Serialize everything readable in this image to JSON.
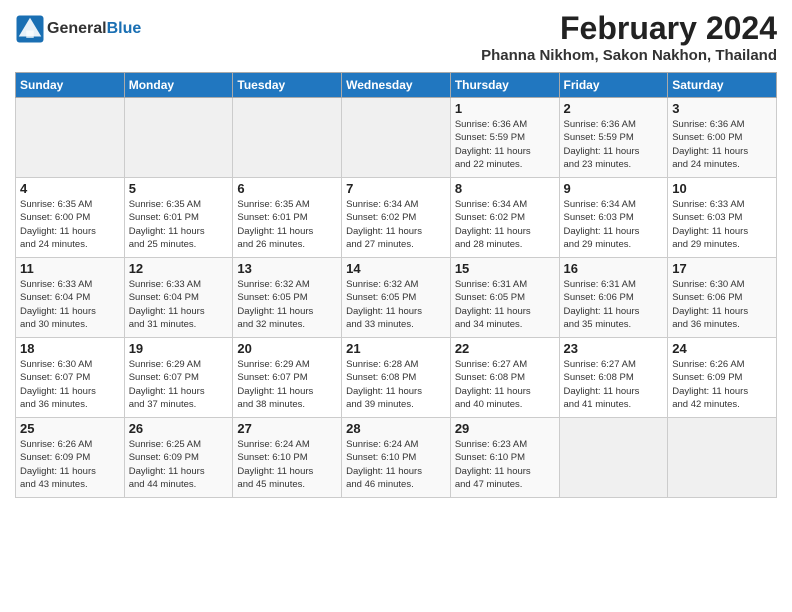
{
  "header": {
    "logo_line1": "General",
    "logo_line2": "Blue",
    "title": "February 2024",
    "subtitle": "Phanna Nikhom, Sakon Nakhon, Thailand"
  },
  "days_of_week": [
    "Sunday",
    "Monday",
    "Tuesday",
    "Wednesday",
    "Thursday",
    "Friday",
    "Saturday"
  ],
  "weeks": [
    [
      {
        "num": "",
        "info": ""
      },
      {
        "num": "",
        "info": ""
      },
      {
        "num": "",
        "info": ""
      },
      {
        "num": "",
        "info": ""
      },
      {
        "num": "1",
        "info": "Sunrise: 6:36 AM\nSunset: 5:59 PM\nDaylight: 11 hours\nand 22 minutes."
      },
      {
        "num": "2",
        "info": "Sunrise: 6:36 AM\nSunset: 5:59 PM\nDaylight: 11 hours\nand 23 minutes."
      },
      {
        "num": "3",
        "info": "Sunrise: 6:36 AM\nSunset: 6:00 PM\nDaylight: 11 hours\nand 24 minutes."
      }
    ],
    [
      {
        "num": "4",
        "info": "Sunrise: 6:35 AM\nSunset: 6:00 PM\nDaylight: 11 hours\nand 24 minutes."
      },
      {
        "num": "5",
        "info": "Sunrise: 6:35 AM\nSunset: 6:01 PM\nDaylight: 11 hours\nand 25 minutes."
      },
      {
        "num": "6",
        "info": "Sunrise: 6:35 AM\nSunset: 6:01 PM\nDaylight: 11 hours\nand 26 minutes."
      },
      {
        "num": "7",
        "info": "Sunrise: 6:34 AM\nSunset: 6:02 PM\nDaylight: 11 hours\nand 27 minutes."
      },
      {
        "num": "8",
        "info": "Sunrise: 6:34 AM\nSunset: 6:02 PM\nDaylight: 11 hours\nand 28 minutes."
      },
      {
        "num": "9",
        "info": "Sunrise: 6:34 AM\nSunset: 6:03 PM\nDaylight: 11 hours\nand 29 minutes."
      },
      {
        "num": "10",
        "info": "Sunrise: 6:33 AM\nSunset: 6:03 PM\nDaylight: 11 hours\nand 29 minutes."
      }
    ],
    [
      {
        "num": "11",
        "info": "Sunrise: 6:33 AM\nSunset: 6:04 PM\nDaylight: 11 hours\nand 30 minutes."
      },
      {
        "num": "12",
        "info": "Sunrise: 6:33 AM\nSunset: 6:04 PM\nDaylight: 11 hours\nand 31 minutes."
      },
      {
        "num": "13",
        "info": "Sunrise: 6:32 AM\nSunset: 6:05 PM\nDaylight: 11 hours\nand 32 minutes."
      },
      {
        "num": "14",
        "info": "Sunrise: 6:32 AM\nSunset: 6:05 PM\nDaylight: 11 hours\nand 33 minutes."
      },
      {
        "num": "15",
        "info": "Sunrise: 6:31 AM\nSunset: 6:05 PM\nDaylight: 11 hours\nand 34 minutes."
      },
      {
        "num": "16",
        "info": "Sunrise: 6:31 AM\nSunset: 6:06 PM\nDaylight: 11 hours\nand 35 minutes."
      },
      {
        "num": "17",
        "info": "Sunrise: 6:30 AM\nSunset: 6:06 PM\nDaylight: 11 hours\nand 36 minutes."
      }
    ],
    [
      {
        "num": "18",
        "info": "Sunrise: 6:30 AM\nSunset: 6:07 PM\nDaylight: 11 hours\nand 36 minutes."
      },
      {
        "num": "19",
        "info": "Sunrise: 6:29 AM\nSunset: 6:07 PM\nDaylight: 11 hours\nand 37 minutes."
      },
      {
        "num": "20",
        "info": "Sunrise: 6:29 AM\nSunset: 6:07 PM\nDaylight: 11 hours\nand 38 minutes."
      },
      {
        "num": "21",
        "info": "Sunrise: 6:28 AM\nSunset: 6:08 PM\nDaylight: 11 hours\nand 39 minutes."
      },
      {
        "num": "22",
        "info": "Sunrise: 6:27 AM\nSunset: 6:08 PM\nDaylight: 11 hours\nand 40 minutes."
      },
      {
        "num": "23",
        "info": "Sunrise: 6:27 AM\nSunset: 6:08 PM\nDaylight: 11 hours\nand 41 minutes."
      },
      {
        "num": "24",
        "info": "Sunrise: 6:26 AM\nSunset: 6:09 PM\nDaylight: 11 hours\nand 42 minutes."
      }
    ],
    [
      {
        "num": "25",
        "info": "Sunrise: 6:26 AM\nSunset: 6:09 PM\nDaylight: 11 hours\nand 43 minutes."
      },
      {
        "num": "26",
        "info": "Sunrise: 6:25 AM\nSunset: 6:09 PM\nDaylight: 11 hours\nand 44 minutes."
      },
      {
        "num": "27",
        "info": "Sunrise: 6:24 AM\nSunset: 6:10 PM\nDaylight: 11 hours\nand 45 minutes."
      },
      {
        "num": "28",
        "info": "Sunrise: 6:24 AM\nSunset: 6:10 PM\nDaylight: 11 hours\nand 46 minutes."
      },
      {
        "num": "29",
        "info": "Sunrise: 6:23 AM\nSunset: 6:10 PM\nDaylight: 11 hours\nand 47 minutes."
      },
      {
        "num": "",
        "info": ""
      },
      {
        "num": "",
        "info": ""
      }
    ]
  ]
}
